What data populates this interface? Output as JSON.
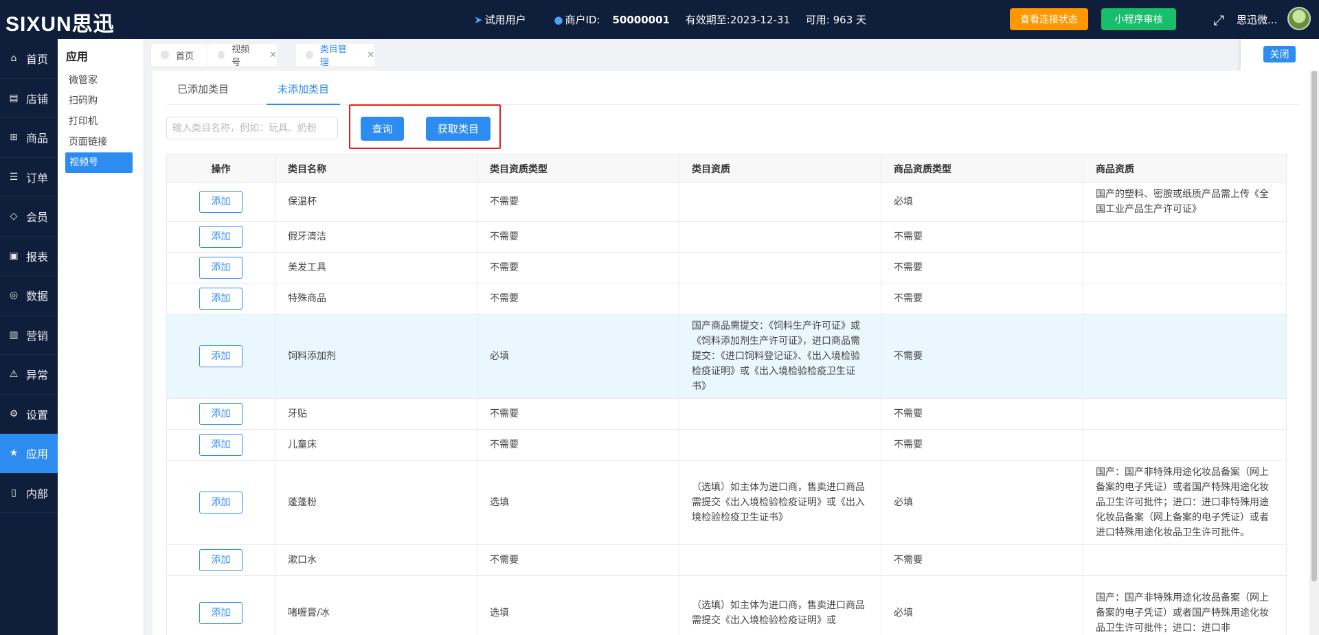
{
  "header": {
    "logo_text": "SIXUN思迅",
    "user_type": "试用用户",
    "merchant_label": "商户ID:",
    "merchant_id": "50000001",
    "valid_until": "有效期至:2023-12-31",
    "available": "可用: 963 天",
    "btn_connection": "查看连接状态",
    "btn_miniapp": "小程序审核",
    "user_name": "思迅微..."
  },
  "leftnav": {
    "items": [
      {
        "label": "首页",
        "icon": "home-icon"
      },
      {
        "label": "店铺",
        "icon": "store-icon"
      },
      {
        "label": "商品",
        "icon": "gift-icon"
      },
      {
        "label": "订单",
        "icon": "order-icon"
      },
      {
        "label": "会员",
        "icon": "diamond-icon"
      },
      {
        "label": "报表",
        "icon": "report-icon"
      },
      {
        "label": "数据",
        "icon": "data-icon"
      },
      {
        "label": "营销",
        "icon": "chart-icon"
      },
      {
        "label": "异常",
        "icon": "warning-icon"
      },
      {
        "label": "设置",
        "icon": "gear-icon"
      },
      {
        "label": "应用",
        "icon": "star-icon"
      },
      {
        "label": "内部",
        "icon": "doc-icon"
      }
    ],
    "active_index": 10
  },
  "submenu": {
    "title": "应用",
    "items": [
      "微管家",
      "扫码购",
      "打印机",
      "页面链接",
      "视频号"
    ],
    "active_index": 4
  },
  "tabs": [
    {
      "label": "首页"
    },
    {
      "label": "视频号"
    },
    {
      "label": "类目管理"
    }
  ],
  "close_label": "关闭",
  "subtabs": [
    "已添加类目",
    "未添加类目"
  ],
  "search": {
    "placeholder": "输入类目名称，例如：玩具、奶粉",
    "query_label": "查询",
    "fetch_label": "获取类目"
  },
  "table": {
    "headers": [
      "操作",
      "类目名称",
      "类目资质类型",
      "类目资质",
      "商品资质类型",
      "商品资质"
    ],
    "add_label": "添加",
    "rows": [
      {
        "name": "保温杯",
        "cat_qual_type": "不需要",
        "cat_qual": "",
        "prod_qual_type": "必填",
        "prod_qual": "国产的塑料、密胺或纸质产品需上传《全国工业产品生产许可证》"
      },
      {
        "name": "假牙清洁",
        "cat_qual_type": "不需要",
        "cat_qual": "",
        "prod_qual_type": "不需要",
        "prod_qual": ""
      },
      {
        "name": "美发工具",
        "cat_qual_type": "不需要",
        "cat_qual": "",
        "prod_qual_type": "不需要",
        "prod_qual": ""
      },
      {
        "name": "特殊商品",
        "cat_qual_type": "不需要",
        "cat_qual": "",
        "prod_qual_type": "不需要",
        "prod_qual": ""
      },
      {
        "name": "饲料添加剂",
        "cat_qual_type": "必填",
        "cat_qual": "国产商品需提交：《饲料生产许可证》或《饲料添加剂生产许可证》，进口商品需提交：《进口饲料登记证》、《出入境检验检疫证明》或《出入境检验检疫卫生证书》",
        "prod_qual_type": "不需要",
        "prod_qual": ""
      },
      {
        "name": "牙贴",
        "cat_qual_type": "不需要",
        "cat_qual": "",
        "prod_qual_type": "不需要",
        "prod_qual": ""
      },
      {
        "name": "儿童床",
        "cat_qual_type": "不需要",
        "cat_qual": "",
        "prod_qual_type": "不需要",
        "prod_qual": ""
      },
      {
        "name": "蓬蓬粉",
        "cat_qual_type": "选填",
        "cat_qual": "（选填）如主体为进口商，售卖进口商品需提交《出入境检验检疫证明》或《出入境检验检疫卫生证书》",
        "prod_qual_type": "必填",
        "prod_qual": "国产：国产非特殊用途化妆品备案（网上备案的电子凭证）或者国产特殊用途化妆品卫生许可批件；进口：进口非特殊用途化妆品备案（网上备案的电子凭证）或者进口特殊用途化妆品卫生许可批件。"
      },
      {
        "name": "漱口水",
        "cat_qual_type": "不需要",
        "cat_qual": "",
        "prod_qual_type": "不需要",
        "prod_qual": ""
      },
      {
        "name": "啫喱膏/冰",
        "cat_qual_type": "选填",
        "cat_qual": "（选填）如主体为进口商，售卖进口商品需提交《出入境检验检疫证明》或",
        "prod_qual_type": "必填",
        "prod_qual": "国产：国产非特殊用途化妆品备案（网上备案的电子凭证）或者国产特殊用途化妆品卫生许可批件；进口：进口非"
      }
    ],
    "highlight_row": 4
  }
}
